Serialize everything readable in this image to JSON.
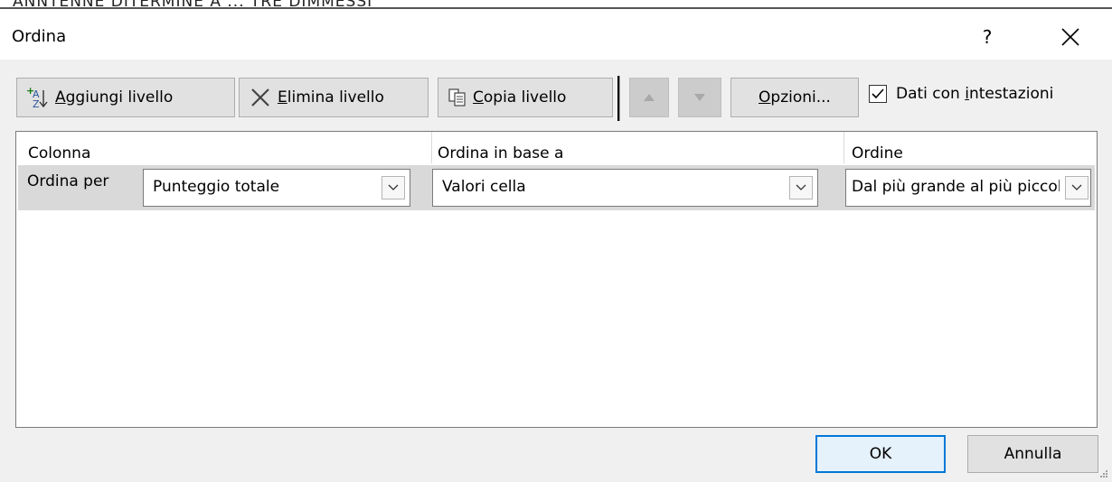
{
  "window": {
    "title": "Ordina",
    "help_label": "?",
    "close_label": "Chiudi"
  },
  "background_partial_text": "ANNTENNE DITERMINE A   ...   TRE DIMMESSI",
  "toolbar": {
    "add_level": {
      "pre": "",
      "u": "A",
      "post": "ggiungi livello"
    },
    "delete_level": {
      "pre": "",
      "u": "E",
      "post": "limina livello"
    },
    "copy_level": {
      "pre": "",
      "u": "C",
      "post": "opia livello"
    },
    "options": {
      "pre": "",
      "u": "O",
      "post": "pzioni..."
    },
    "move_up_icon": "up-triangle",
    "move_down_icon": "down-triangle"
  },
  "headers_checkbox": {
    "pre": "Dati con ",
    "u": "i",
    "post": "ntestazioni",
    "checked": true
  },
  "grid": {
    "columns": [
      "Colonna",
      "Ordina in base a",
      "Ordine"
    ],
    "rows": [
      {
        "label": "Ordina per",
        "column_value": "Punteggio totale",
        "sort_on": "Valori cella",
        "order": "Dal più grande al più piccolo"
      }
    ]
  },
  "buttons": {
    "ok": "OK",
    "cancel": "Annulla"
  },
  "colors": {
    "accent": "#0078d7",
    "row_selected": "#d9d9d9",
    "dialog_bg": "#f0f0f0"
  }
}
